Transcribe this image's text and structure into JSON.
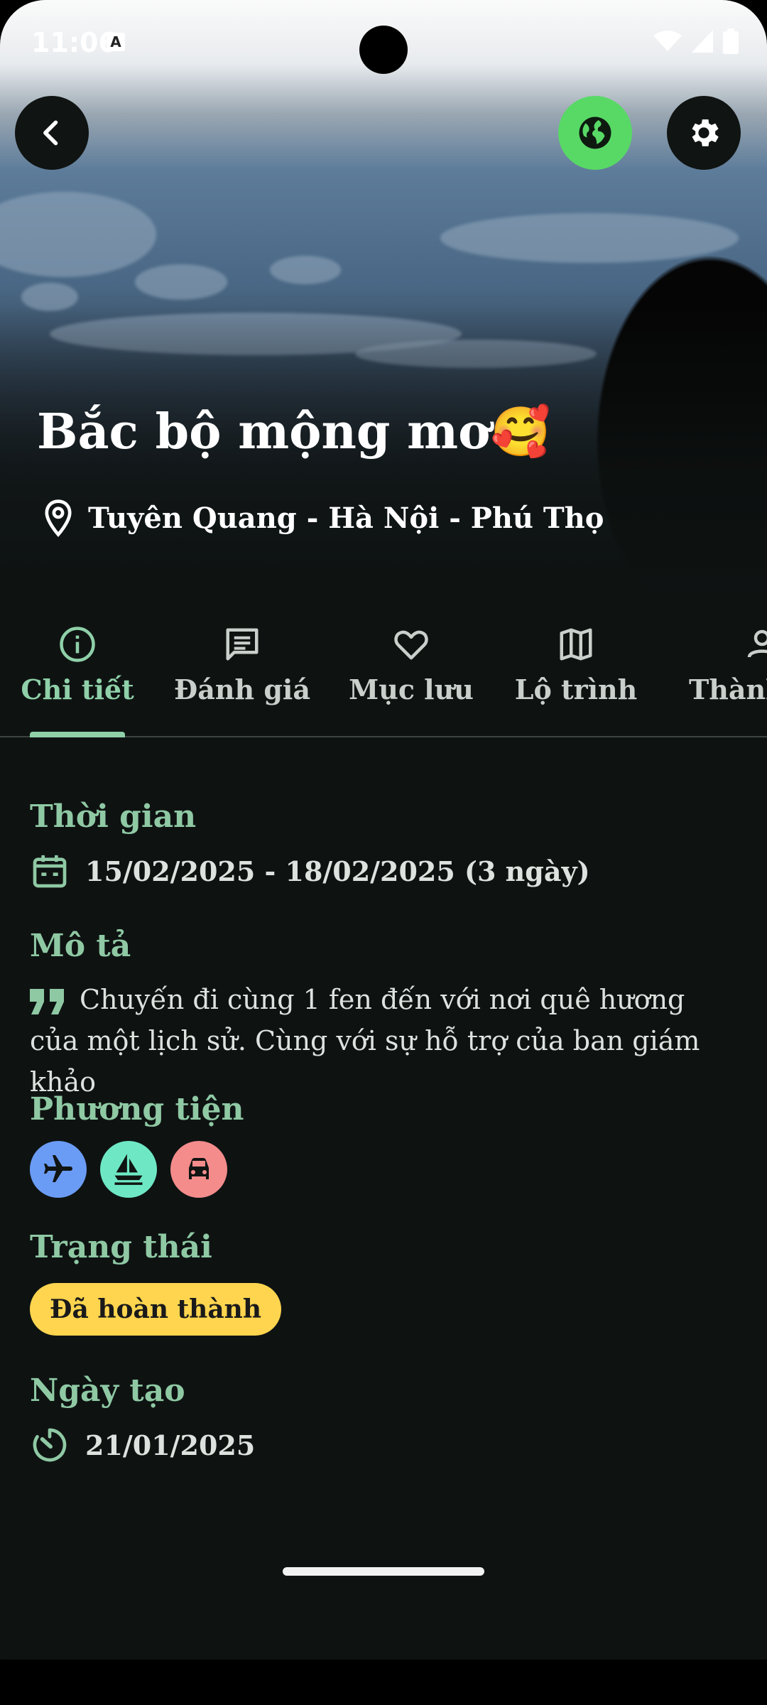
{
  "status_bar": {
    "time": "11:06",
    "indicator": "A"
  },
  "header": {
    "back_icon": "chevron-left-icon",
    "globe_icon": "globe-icon",
    "settings_icon": "gear-icon",
    "accent_color": "#58d966"
  },
  "trip": {
    "title": "Bắc bộ mộng mơ🥰",
    "location": "Tuyên Quang - Hà Nội - Phú Thọ"
  },
  "tabs": [
    {
      "label": "Chi tiết",
      "icon": "info-icon",
      "active": true
    },
    {
      "label": "Đánh giá",
      "icon": "comment-icon",
      "active": false
    },
    {
      "label": "Mục lưu",
      "icon": "heart-icon",
      "active": false
    },
    {
      "label": "Lộ trình",
      "icon": "map-icon",
      "active": false
    },
    {
      "label": "Thành",
      "icon": "person-icon",
      "active": false
    }
  ],
  "details": {
    "time_title": "Thời gian",
    "time_value": "15/02/2025 - 18/02/2025 (3 ngày)",
    "description_title": "Mô tả",
    "description_text": "Chuyến đi cùng 1 fen đến với nơi quê hương của một lịch sử. Cùng với sự hỗ trợ của ban giám khảo",
    "transport_title": "Phương tiện",
    "transport": [
      {
        "icon": "airplane-icon",
        "color": "#6b9cf5"
      },
      {
        "icon": "sailboat-icon",
        "color": "#6ee8c4"
      },
      {
        "icon": "car-icon",
        "color": "#f48c8c"
      }
    ],
    "status_title": "Trạng thái",
    "status_value": "Đã hoàn thành",
    "status_color": "#ffd54f",
    "created_title": "Ngày tạo",
    "created_value": "21/01/2025"
  },
  "theme": {
    "accent": "#8fc9a4",
    "background": "#0e1312"
  }
}
